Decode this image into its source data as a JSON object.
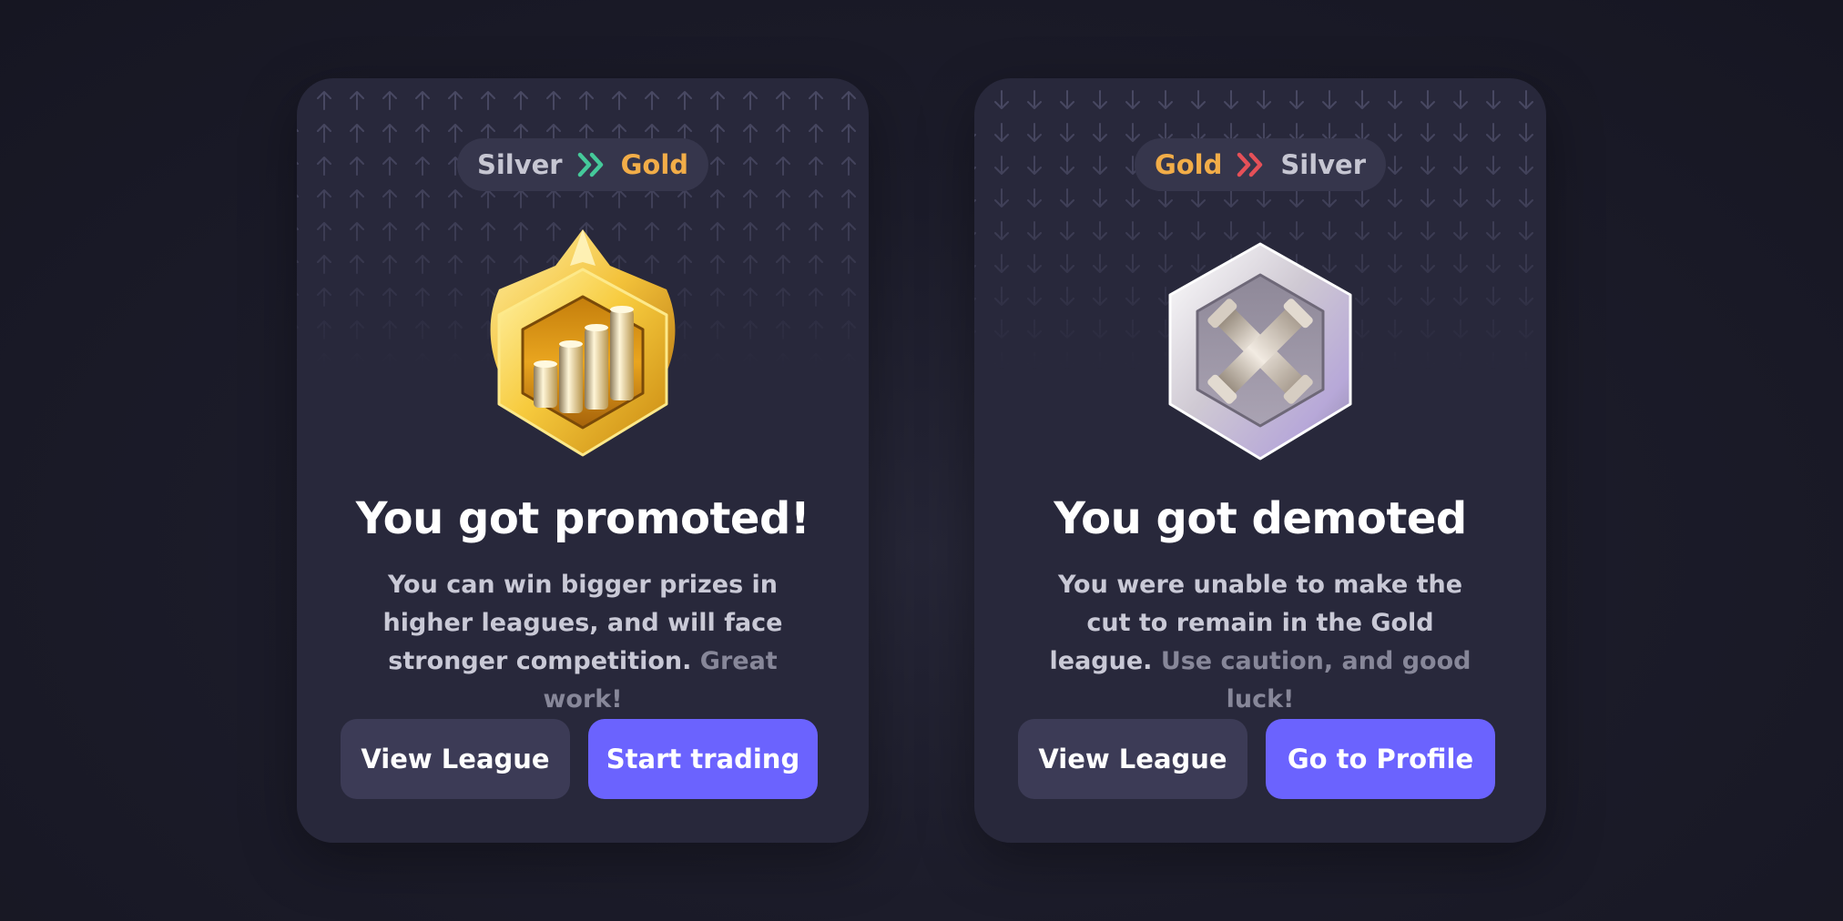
{
  "colors": {
    "background": "#1c1c2a",
    "card": "#28283b",
    "pill": "#36364c",
    "silver_text": "#c6c6d2",
    "gold_text": "#f2ad48",
    "promote_chevron": "#45c99a",
    "demote_chevron": "#e55058",
    "primary_button": "#6b63fe",
    "secondary_button": "#3c3b56"
  },
  "promoted": {
    "from_league": "Silver",
    "to_league": "Gold",
    "chevron_icon": "double-chevron-right-icon",
    "badge_icon": "gold-league-badge-icon",
    "title": "You got promoted!",
    "description": "You can win bigger prizes in higher leagues, and will face stronger competition.",
    "description_highlight": "Great work!",
    "secondary_button": "View League",
    "primary_button": "Start trading"
  },
  "demoted": {
    "from_league": "Gold",
    "to_league": "Silver",
    "chevron_icon": "double-chevron-right-icon",
    "badge_icon": "silver-league-badge-icon",
    "title": "You got demoted",
    "description": "You were unable to make the cut to remain in the Gold league.",
    "description_highlight": "Use caution, and good luck!",
    "secondary_button": "View League",
    "primary_button": "Go to Profile"
  }
}
